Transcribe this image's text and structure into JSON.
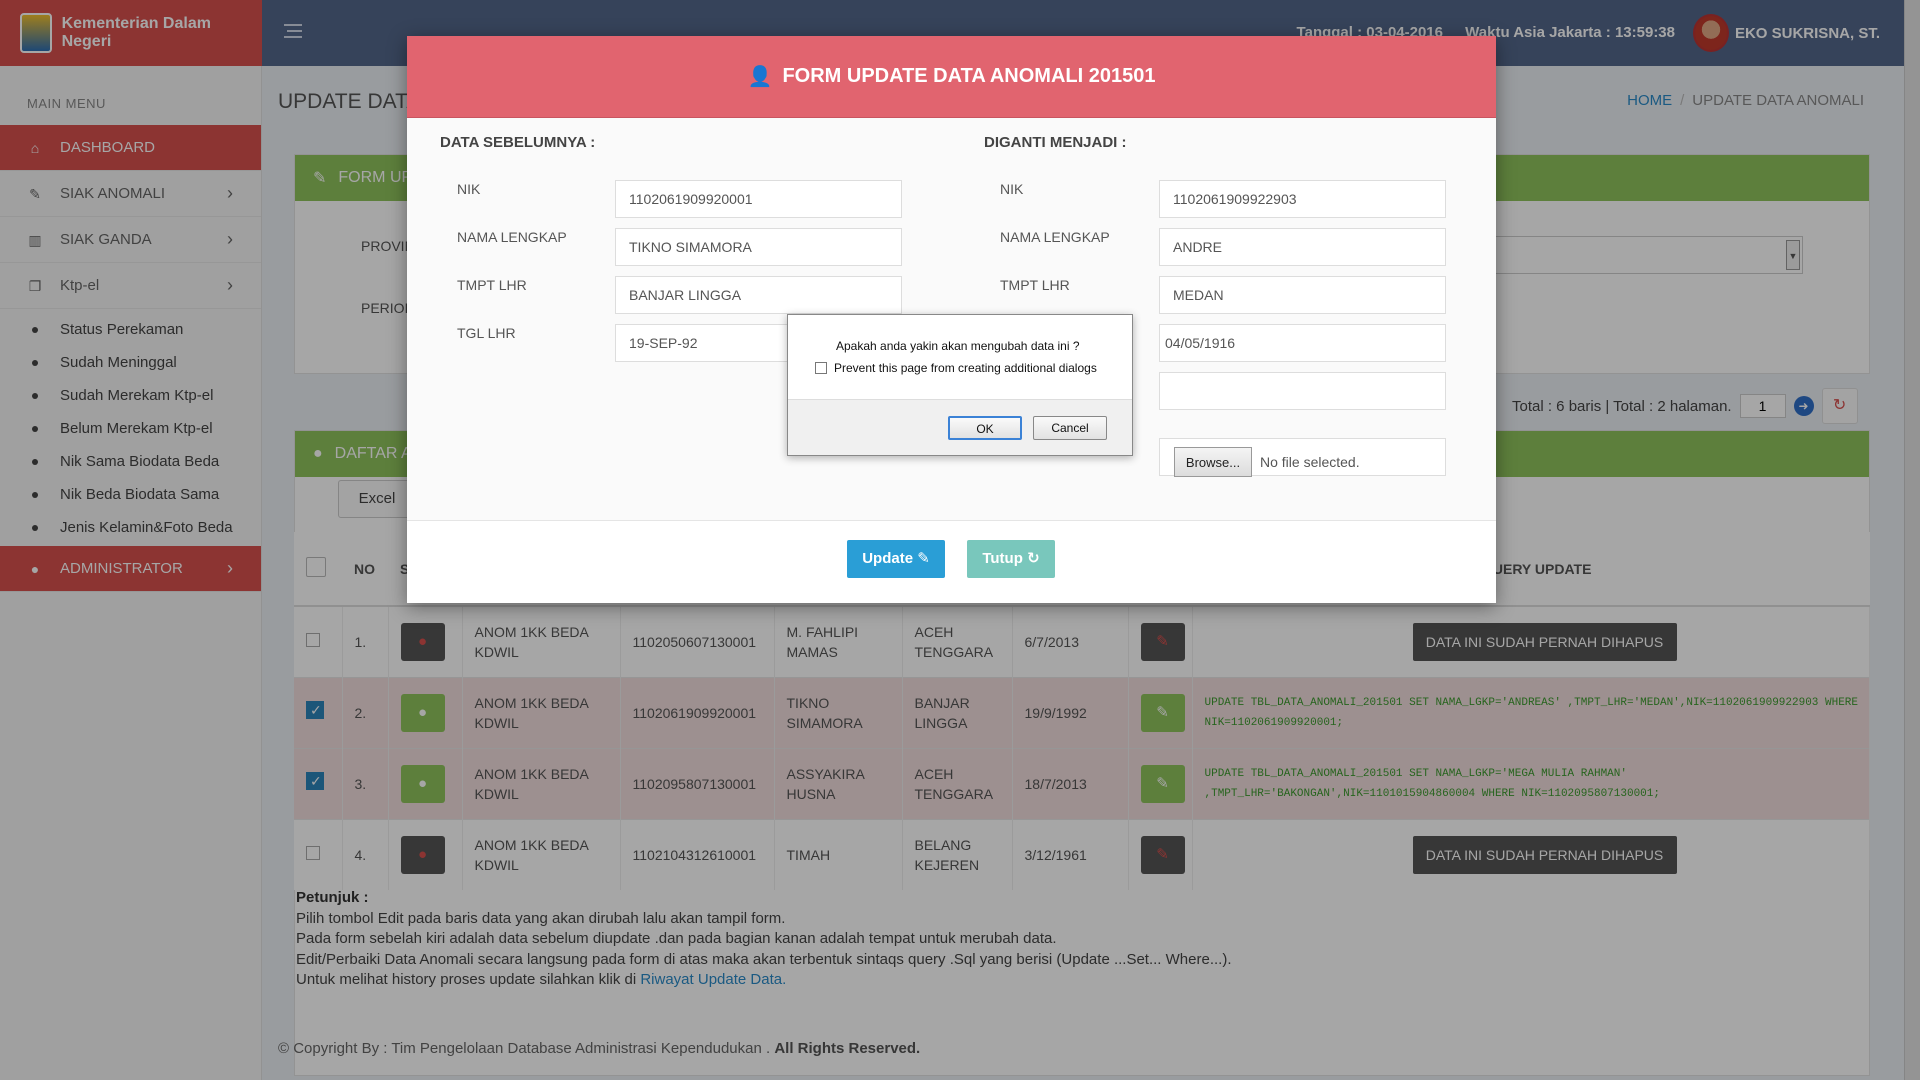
{
  "header": {
    "brand": "Kementerian Dalam Negeri",
    "date_text": "Tanggal : 03-04-2016",
    "time_text": "Waktu Asia Jakarta : 13:59:38",
    "user_name": "EKO SUKRISNA, ST."
  },
  "sidebar": {
    "heading": "MAIN MENU",
    "items": [
      {
        "label": "DASHBOARD",
        "icon": "home-icon"
      },
      {
        "label": "SIAK ANOMALI",
        "icon": "edit-icon"
      },
      {
        "label": "SIAK GANDA",
        "icon": "trash-icon"
      },
      {
        "label": "Ktp-el",
        "icon": "copy-icon"
      }
    ],
    "subitems": [
      "Status Perekaman",
      "Sudah Meninggal",
      "Sudah Merekam Ktp-el",
      "Belum Merekam Ktp-el",
      "Nik Sama Biodata Beda",
      "Nik Beda Biodata Sama",
      "Jenis Kelamin&Foto Beda"
    ],
    "admin": "ADMINISTRATOR"
  },
  "page": {
    "title": "UPDATE DATA ANOMALI",
    "breadcrumb_home": "HOME",
    "breadcrumb_current": "UPDATE DATA ANOMALI"
  },
  "form_panel": {
    "title": "FORM UPDATE",
    "label_provinsi": "PROVINSI",
    "label_periode": "PERIODE"
  },
  "list_panel": {
    "title": "DAFTAR ANOMALI",
    "excel_label": "Excel",
    "totals_text": "Total : 6 baris | Total : 2 halaman.",
    "page_value": "1",
    "columns": {
      "no": "NO",
      "s": "S",
      "query": "QUERY UPDATE"
    }
  },
  "rows": [
    {
      "no": "1.",
      "jenis": "ANOM 1KK BEDA KDWIL",
      "nik": "1102050607130001",
      "nama": "M. FAHLIPI MAMAS",
      "tempat": "ACEH TENGGARA",
      "tgl": "6/7/2013",
      "checked": false,
      "status": "deleted",
      "note": "DATA INI SUDAH PERNAH DIHAPUS"
    },
    {
      "no": "2.",
      "jenis": "ANOM 1KK BEDA KDWIL",
      "nik": "1102061909920001",
      "nama": "TIKNO SIMAMORA",
      "tempat": "BANJAR LINGGA",
      "tgl": "19/9/1992",
      "checked": true,
      "status": "query",
      "note": "UPDATE TBL_DATA_ANOMALI_201501 SET NAMA_LGKP='ANDREAS' ,TMPT_LHR='MEDAN',NIK=1102061909922903 WHERE NIK=1102061909920001;"
    },
    {
      "no": "3.",
      "jenis": "ANOM 1KK BEDA KDWIL",
      "nik": "1102095807130001",
      "nama": "ASSYAKIRA HUSNA",
      "tempat": "ACEH TENGGARA",
      "tgl": "18/7/2013",
      "checked": true,
      "status": "query",
      "note": "UPDATE TBL_DATA_ANOMALI_201501 SET NAMA_LGKP='MEGA MULIA RAHMAN' ,TMPT_LHR='BAKONGAN',NIK=1101015904860004 WHERE NIK=1102095807130001;"
    },
    {
      "no": "4.",
      "jenis": "ANOM 1KK BEDA KDWIL",
      "nik": "1102104312610001",
      "nama": "TIMAH",
      "tempat": "BELANG KEJEREN",
      "tgl": "3/12/1961",
      "checked": false,
      "status": "deleted",
      "note": "DATA INI SUDAH PERNAH DIHAPUS"
    }
  ],
  "notes": {
    "title": "Petunjuk :",
    "line1": "Pilih tombol Edit pada baris data yang akan dirubah lalu akan tampil form.",
    "line2": "Pada form sebelah kiri adalah data sebelum diupdate .dan pada bagian kanan adalah tempat untuk merubah data.",
    "line3": "Edit/Perbaiki Data Anomali secara langsung pada form di atas maka akan terbentuk sintaqs query .Sql yang berisi (Update ...Set... Where...).",
    "line4_prefix": "Untuk melihat history proses update silahkan klik di ",
    "line4_link": "Riwayat Update Data."
  },
  "footer": {
    "text": "© Copyright By : Tim Pengelolaan Database Administrasi Kependudukan . ",
    "bold": "All Rights Reserved."
  },
  "modal": {
    "title": "FORM UPDATE DATA ANOMALI 201501",
    "left_heading": "DATA SEBELUMNYA :",
    "right_heading": "DIGANTI MENJADI :",
    "labels": {
      "nik": "NIK",
      "nama": "NAMA LENGKAP",
      "tmpt": "TMPT LHR",
      "tgl": "TGL LHR"
    },
    "before": {
      "nik": "1102061909920001",
      "nama": "TIKNO SIMAMORA",
      "tmpt": "BANJAR LINGGA",
      "tgl": "19-SEP-92"
    },
    "after": {
      "nik": "1102061909922903",
      "nama": "ANDRE",
      "tmpt": "MEDAN",
      "tgl": "04/05/1916"
    },
    "browse_label": "Browse...",
    "no_file": "No file selected.",
    "update_label": "Update",
    "tutup_label": "Tutup"
  },
  "dialog": {
    "message": "Apakah anda yakin akan mengubah data ini ?",
    "checkbox_label": "Prevent this page from creating additional dialogs",
    "ok": "OK",
    "cancel": "Cancel"
  },
  "colors": {
    "brand": "#d8504e",
    "header": "#54678a",
    "panel": "#8fc45d",
    "modal_head": "#e1646f",
    "update_btn": "#2a9ed6",
    "tutup_btn": "#79c7bc"
  }
}
